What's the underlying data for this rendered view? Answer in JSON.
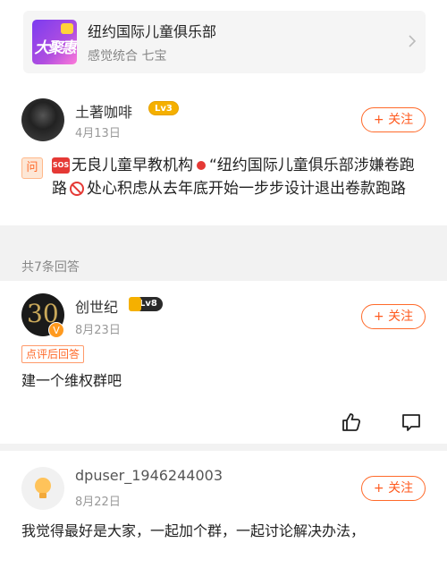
{
  "shop_card": {
    "logo_text": "大聚惠",
    "name": "纽约国际儿童俱乐部",
    "tags": "感觉统合  七宝"
  },
  "question": {
    "user": {
      "name": "土著咖啡",
      "level": "Lv3",
      "date": "4月13日"
    },
    "follow_label": "+ 关注",
    "q_mark": "问",
    "text_part1": "无良儿童早教机构",
    "text_part2": "“纽约国际儿童俱乐部涉嫌卷跑路",
    "text_part3": "处心积虑从去年底开始一步步设计退出卷款跑路",
    "sos_label": "SOS"
  },
  "answers_count": "共7条回答",
  "answers": [
    {
      "user": {
        "name": "创世纪",
        "level": "Lv8",
        "date": "8月23日",
        "avatar_text": "30",
        "verified": "V"
      },
      "tag": "点评后回答",
      "text": "建一个维权群吧",
      "follow_label": "+ 关注"
    },
    {
      "user": {
        "name": "dpuser_1946244003",
        "date": "8月22日"
      },
      "text": "我觉得最好是大家，一起加个群，一起讨论解决办法，",
      "follow_label": "+ 关注"
    }
  ],
  "icons": {
    "like": "thumbs-up-icon",
    "comment": "comment-icon",
    "chevron": "chevron-right-icon"
  },
  "colors": {
    "accent": "#ff5a1f",
    "gap": "#f2f2f2"
  }
}
